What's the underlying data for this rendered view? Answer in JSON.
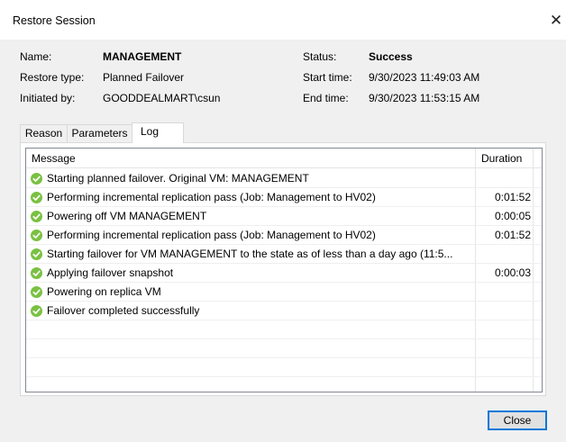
{
  "window": {
    "title": "Restore Session",
    "close_glyph": "✕"
  },
  "info": {
    "name_label": "Name:",
    "name_value": "MANAGEMENT",
    "restore_type_label": "Restore type:",
    "restore_type_value": "Planned Failover",
    "initiated_by_label": "Initiated by:",
    "initiated_by_value": "GOODDEALMART\\csun",
    "status_label": "Status:",
    "status_value": "Success",
    "start_time_label": "Start time:",
    "start_time_value": "9/30/2023 11:49:03 AM",
    "end_time_label": "End time:",
    "end_time_value": "9/30/2023 11:53:15 AM"
  },
  "tabs": [
    {
      "label": "Reason",
      "active": false
    },
    {
      "label": "Parameters",
      "active": false
    },
    {
      "label": "Log",
      "active": true
    }
  ],
  "log": {
    "columns": [
      "Message",
      "Duration"
    ],
    "status_icon": "success-check-icon",
    "status_color": "#7ac142",
    "rows": [
      {
        "message": "Starting planned failover. Original VM: MANAGEMENT",
        "duration": ""
      },
      {
        "message": "Performing incremental replication pass (Job: Management to HV02)",
        "duration": "0:01:52"
      },
      {
        "message": "Powering off VM MANAGEMENT",
        "duration": "0:00:05"
      },
      {
        "message": "Performing incremental replication pass (Job: Management to HV02)",
        "duration": "0:01:52"
      },
      {
        "message": "Starting failover for VM MANAGEMENT to the state as of less than a day ago (11:5...",
        "duration": ""
      },
      {
        "message": "Applying failover snapshot",
        "duration": "0:00:03"
      },
      {
        "message": "Powering on replica VM",
        "duration": ""
      },
      {
        "message": "Failover completed successfully",
        "duration": ""
      }
    ]
  },
  "buttons": {
    "close_label": "Close"
  }
}
